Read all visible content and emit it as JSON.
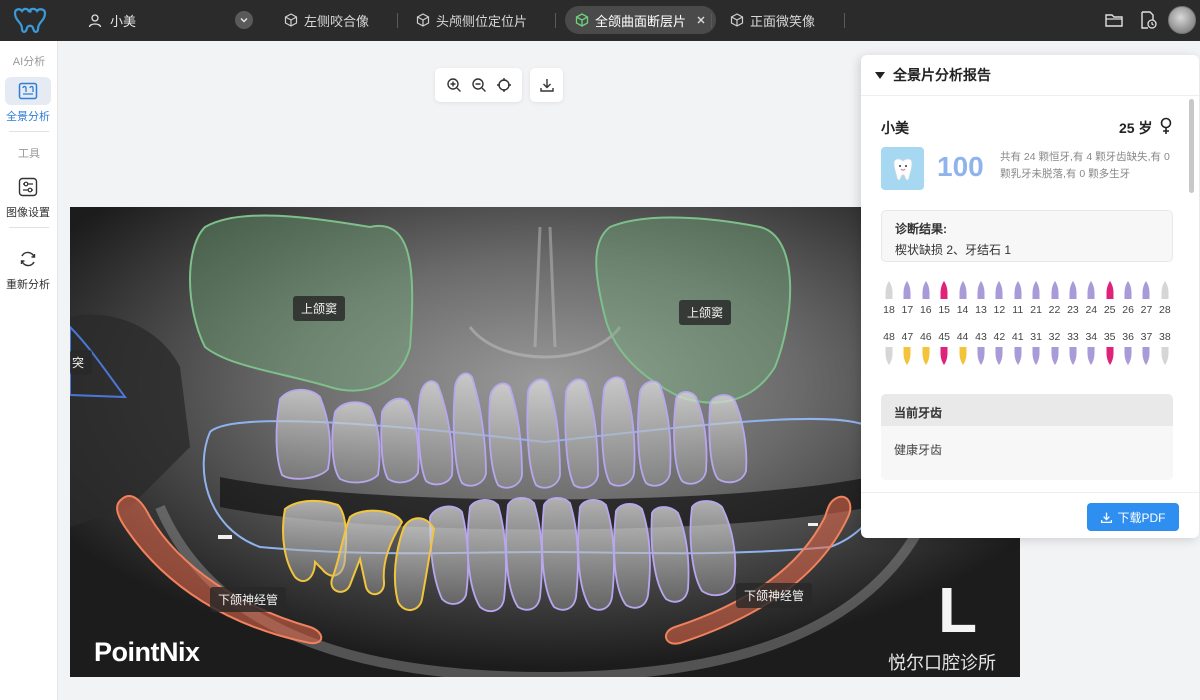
{
  "topbar": {
    "user_name": "小美",
    "tabs": [
      {
        "label": "左侧咬合像",
        "active": false
      },
      {
        "label": "头颅侧位定位片",
        "active": false
      },
      {
        "label": "全颌曲面断层片",
        "active": true
      },
      {
        "label": "正面微笑像",
        "active": false
      }
    ],
    "icons": [
      "folder-icon",
      "document-clock-icon",
      "avatar"
    ]
  },
  "sidebar": {
    "section_ai": "AI分析",
    "section_tools": "工具",
    "items": [
      {
        "label": "全景分析",
        "icon": "panorama-analysis-icon",
        "active": true
      },
      {
        "label": "图像设置",
        "icon": "sliders-icon",
        "active": false
      },
      {
        "label": "重新分析",
        "icon": "refresh-icon",
        "active": false
      }
    ]
  },
  "toolbar": {
    "tools": [
      "zoom-in-icon",
      "zoom-out-icon",
      "reset-view-icon",
      "download-icon"
    ]
  },
  "xray": {
    "labels": {
      "maxillary_sinus_right": "上颌窦",
      "maxillary_sinus_left": "上颌窦",
      "condyle_partial": "突",
      "nerve_right": "下颌神经管",
      "nerve_left": "下颌神经管"
    },
    "brand": "PointNix",
    "marker": "L",
    "clinic": "悦尔口腔诊所"
  },
  "report": {
    "title": "全景片分析报告",
    "patient_name": "小美",
    "age": "25 岁",
    "score": "100",
    "summary": "共有 24 颗恒牙,有 4 颗牙齿缺失,有 0 颗乳牙未脱落,有 0 颗多生牙",
    "diagnosis_title": "诊断结果:",
    "diagnosis_text": "楔状缺损 2、牙结石 1",
    "upper_teeth": [
      {
        "num": "18",
        "status": "missing"
      },
      {
        "num": "17",
        "status": "healthy"
      },
      {
        "num": "16",
        "status": "healthy"
      },
      {
        "num": "15",
        "status": "defect"
      },
      {
        "num": "14",
        "status": "healthy"
      },
      {
        "num": "13",
        "status": "healthy"
      },
      {
        "num": "12",
        "status": "healthy"
      },
      {
        "num": "11",
        "status": "healthy"
      },
      {
        "num": "21",
        "status": "healthy"
      },
      {
        "num": "22",
        "status": "healthy"
      },
      {
        "num": "23",
        "status": "healthy"
      },
      {
        "num": "24",
        "status": "healthy"
      },
      {
        "num": "25",
        "status": "defect"
      },
      {
        "num": "26",
        "status": "healthy"
      },
      {
        "num": "27",
        "status": "healthy"
      },
      {
        "num": "28",
        "status": "missing"
      }
    ],
    "lower_teeth": [
      {
        "num": "48",
        "status": "missing"
      },
      {
        "num": "47",
        "status": "treated"
      },
      {
        "num": "46",
        "status": "treated"
      },
      {
        "num": "45",
        "status": "defect"
      },
      {
        "num": "44",
        "status": "treated"
      },
      {
        "num": "43",
        "status": "healthy"
      },
      {
        "num": "42",
        "status": "healthy"
      },
      {
        "num": "41",
        "status": "healthy"
      },
      {
        "num": "31",
        "status": "healthy"
      },
      {
        "num": "32",
        "status": "healthy"
      },
      {
        "num": "33",
        "status": "healthy"
      },
      {
        "num": "34",
        "status": "healthy"
      },
      {
        "num": "35",
        "status": "defect"
      },
      {
        "num": "36",
        "status": "healthy"
      },
      {
        "num": "37",
        "status": "healthy"
      },
      {
        "num": "38",
        "status": "missing"
      }
    ],
    "current_title": "当前牙齿",
    "current_value": "健康牙齿",
    "pdf_button": "下载PDF"
  },
  "colors": {
    "healthy": "#a99ad8",
    "defect": "#e0237a",
    "treated": "#f3c43a",
    "missing": "#d6d6d6",
    "accent": "#2f8ff0",
    "sinus": "#7fc08a",
    "teeth_outline": "#b8a6ee",
    "restoration_outline": "#f2c53d",
    "arch": "#90b2ee",
    "nerve": "#f0825e"
  }
}
